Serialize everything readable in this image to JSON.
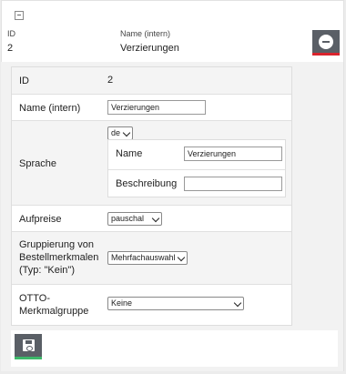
{
  "header": {
    "id_label": "ID",
    "id_value": "2",
    "name_label": "Name (intern)",
    "name_value": "Verzierungen"
  },
  "form": {
    "id": {
      "label": "ID",
      "value": "2"
    },
    "name_intern": {
      "label": "Name (intern)",
      "value": "Verzierungen"
    },
    "sprache": {
      "label": "Sprache",
      "language": "de",
      "name_label": "Name",
      "name_value": "Verzierungen",
      "beschreibung_label": "Beschreibung",
      "beschreibung_value": ""
    },
    "aufpreise": {
      "label": "Aufpreise",
      "selected": "pauschal"
    },
    "gruppierung": {
      "label": "Gruppierung von Bestellmerkmalen (Typ: \"Kein\")",
      "selected": "Mehrfachauswahl"
    },
    "otto": {
      "label": "OTTO-Merkmalgruppe",
      "selected": "Keine"
    }
  },
  "icons": {
    "collapse": "minus-square-icon",
    "remove": "minus-circle-icon",
    "save": "floppy-disk-icon"
  },
  "colors": {
    "button_bg": "#5a5f66",
    "remove_accent": "#d9232d",
    "save_accent": "#3db86a"
  }
}
